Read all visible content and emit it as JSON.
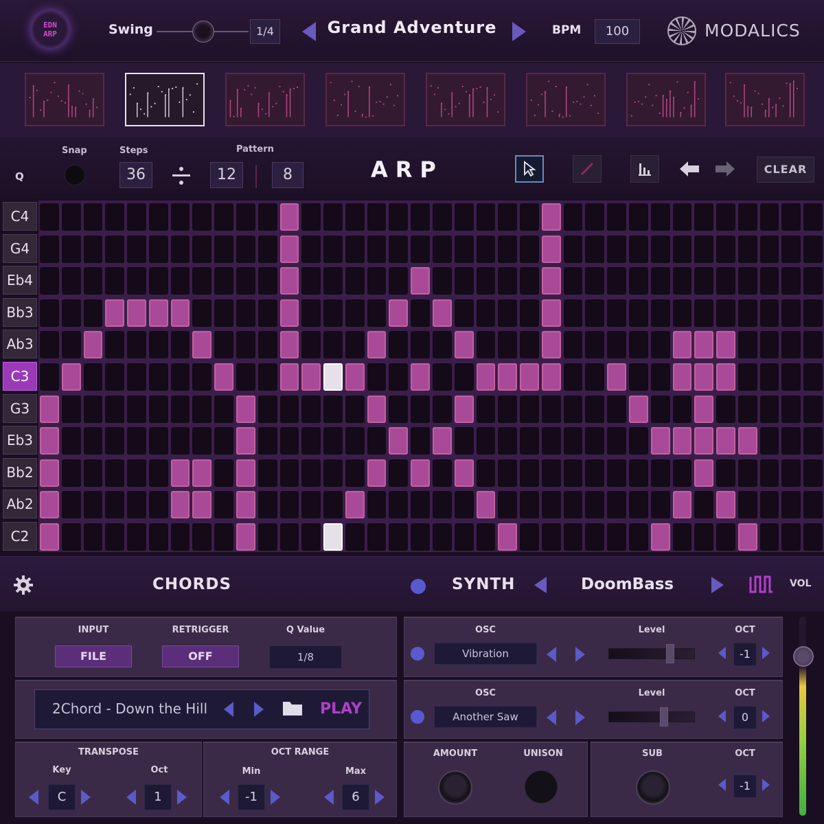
{
  "header": {
    "logo_line1": "EDN",
    "logo_line2": "ARP",
    "swing_label": "Swing",
    "swing_value": "1/4",
    "preset_name": "Grand Adventure",
    "bpm_label": "BPM",
    "bpm_value": "100",
    "brand": "MODALICS"
  },
  "thumbnails": {
    "count": 8,
    "selected_index": 1
  },
  "toolbar": {
    "q_label": "Q",
    "snap_label": "Snap",
    "steps_label": "Steps",
    "pattern_label": "Pattern",
    "steps_value": "36",
    "divisor_value": "12",
    "pattern_value": "8",
    "title": "ARP",
    "clear_label": "CLEAR",
    "tools": [
      "select-tool",
      "pencil-tool",
      "velocity-tool",
      "undo",
      "redo"
    ]
  },
  "grid": {
    "notes": [
      "C4",
      "G4",
      "Eb4",
      "Bb3",
      "Ab3",
      "C3",
      "G3",
      "Eb3",
      "Bb2",
      "Ab2",
      "C2"
    ],
    "active_note": "C3",
    "columns": 36,
    "active_cells": [
      [
        0,
        11
      ],
      [
        0,
        23
      ],
      [
        1,
        11
      ],
      [
        1,
        23
      ],
      [
        2,
        11
      ],
      [
        2,
        17
      ],
      [
        2,
        23
      ],
      [
        3,
        3
      ],
      [
        3,
        4
      ],
      [
        3,
        5
      ],
      [
        3,
        6
      ],
      [
        3,
        11
      ],
      [
        3,
        16
      ],
      [
        3,
        18
      ],
      [
        3,
        23
      ],
      [
        4,
        2
      ],
      [
        4,
        7
      ],
      [
        4,
        11
      ],
      [
        4,
        15
      ],
      [
        4,
        19
      ],
      [
        4,
        23
      ],
      [
        4,
        29
      ],
      [
        4,
        30
      ],
      [
        4,
        31
      ],
      [
        5,
        1
      ],
      [
        5,
        8
      ],
      [
        5,
        11
      ],
      [
        5,
        12
      ],
      [
        5,
        14
      ],
      [
        5,
        17
      ],
      [
        5,
        20
      ],
      [
        5,
        21
      ],
      [
        5,
        22
      ],
      [
        5,
        23
      ],
      [
        5,
        26
      ],
      [
        5,
        29
      ],
      [
        5,
        30
      ],
      [
        5,
        31
      ],
      [
        6,
        0
      ],
      [
        6,
        9
      ],
      [
        6,
        15
      ],
      [
        6,
        19
      ],
      [
        6,
        27
      ],
      [
        6,
        30
      ],
      [
        7,
        0
      ],
      [
        7,
        9
      ],
      [
        7,
        16
      ],
      [
        7,
        18
      ],
      [
        7,
        28
      ],
      [
        7,
        29
      ],
      [
        7,
        30
      ],
      [
        7,
        31
      ],
      [
        7,
        32
      ],
      [
        8,
        0
      ],
      [
        8,
        6
      ],
      [
        8,
        7
      ],
      [
        8,
        9
      ],
      [
        8,
        15
      ],
      [
        8,
        17
      ],
      [
        8,
        19
      ],
      [
        8,
        30
      ],
      [
        9,
        0
      ],
      [
        9,
        6
      ],
      [
        9,
        7
      ],
      [
        9,
        9
      ],
      [
        9,
        14
      ],
      [
        9,
        20
      ],
      [
        9,
        29
      ],
      [
        9,
        31
      ],
      [
        10,
        0
      ],
      [
        10,
        9
      ],
      [
        10,
        21
      ],
      [
        10,
        28
      ],
      [
        10,
        32
      ]
    ],
    "highlight_cells": [
      [
        5,
        13
      ],
      [
        10,
        13
      ]
    ]
  },
  "chords_bar": {
    "title": "CHORDS",
    "synth_title": "SYNTH",
    "synth_preset": "DoomBass",
    "vol_label": "VOL"
  },
  "chords": {
    "input_label": "INPUT",
    "input_value": "FILE",
    "retrigger_label": "RETRIGGER",
    "retrigger_value": "OFF",
    "q_value_label": "Q Value",
    "q_value": "1/8",
    "file_name": "2Chord - Down the Hill",
    "play_label": "PLAY",
    "transpose_label": "TRANSPOSE",
    "key_label": "Key",
    "key_value": "C",
    "oct_label": "Oct",
    "oct_value": "1",
    "oct_range_label": "OCT RANGE",
    "min_label": "Min",
    "min_value": "-1",
    "max_label": "Max",
    "max_value": "6"
  },
  "synth": {
    "osc1_label": "OSC",
    "osc1_wave": "Vibration",
    "osc1_level_label": "Level",
    "osc1_level": 0.74,
    "osc1_oct_label": "OCT",
    "osc1_oct": "-1",
    "osc2_label": "OSC",
    "osc2_wave": "Another Saw",
    "osc2_level_label": "Level",
    "osc2_level": 0.66,
    "osc2_oct_label": "OCT",
    "osc2_oct": "0",
    "amount_label": "AMOUNT",
    "unison_label": "UNISON",
    "sub_label": "SUB",
    "sub_oct_label": "OCT",
    "sub_oct": "-1",
    "volume": 0.8
  },
  "colors": {
    "cell_on": "#a84a98",
    "cell_highlight": "#e8e0e8",
    "accent": "#5a5ad0"
  }
}
